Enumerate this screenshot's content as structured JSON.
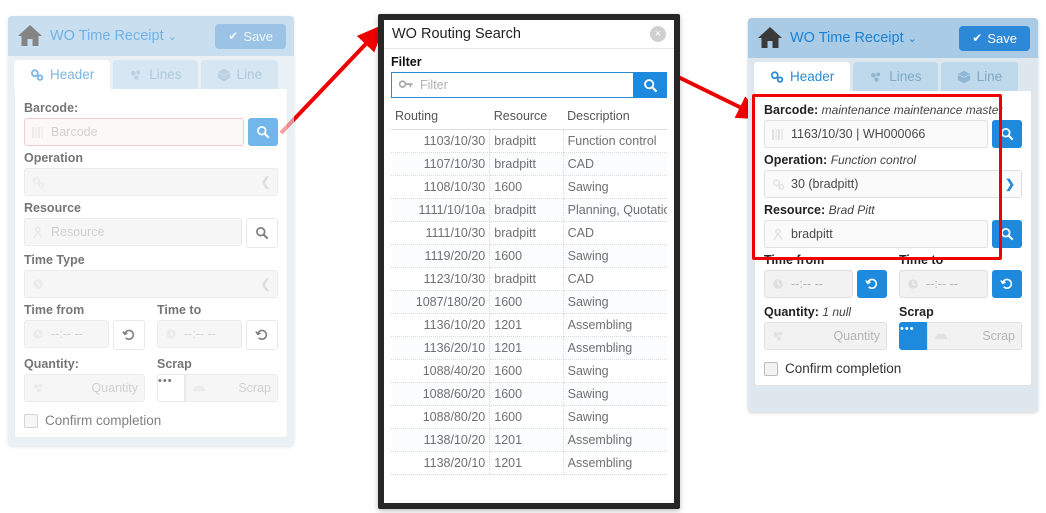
{
  "app": {
    "title": "WO Time Receipt",
    "caret": "⌄",
    "save_label": "Save",
    "home_icon": "home-icon",
    "tabs": [
      {
        "label": "Header",
        "icon": "gears-icon",
        "active": true
      },
      {
        "label": "Lines",
        "icon": "molecule-icon",
        "active": false
      },
      {
        "label": "Line",
        "icon": "box-icon",
        "active": false
      }
    ]
  },
  "left_panel": {
    "barcode": {
      "label": "Barcode:",
      "placeholder": "Barcode",
      "value": "",
      "icon": "barcode-icon",
      "search_icon": "search-icon"
    },
    "operation": {
      "label": "Operation",
      "placeholder": "",
      "value": "",
      "icon": "gears-icon",
      "chevron": "chevron-down-icon"
    },
    "resource": {
      "label": "Resource",
      "placeholder": "Resource",
      "value": "",
      "icon": "person-icon",
      "search_icon": "search-icon"
    },
    "time_type": {
      "label": "Time Type",
      "placeholder": "",
      "value": "",
      "icon": "clock-icon",
      "chevron": "chevron-down-icon"
    },
    "time_from": {
      "label": "Time from",
      "placeholder": "--:-- --",
      "value": "",
      "icon": "clock-icon",
      "button_icon": "history-icon"
    },
    "time_to": {
      "label": "Time to",
      "placeholder": "--:-- --",
      "value": "",
      "icon": "clock-icon",
      "button_icon": "history-icon"
    },
    "quantity": {
      "label": "Quantity:",
      "placeholder": "Quantity",
      "value": "",
      "icon": "cubes-icon"
    },
    "scrap": {
      "label": "Scrap",
      "placeholder": "Scrap",
      "value": "",
      "icon": "scrap-icon",
      "dots_label": "•••"
    },
    "confirm": {
      "label": "Confirm completion",
      "checked": false
    }
  },
  "modal": {
    "title": "WO Routing Search",
    "close_label": "×",
    "filter_label": "Filter",
    "filter_placeholder": "Filter",
    "filter_value": "",
    "filter_icon": "key-icon",
    "search_icon": "search-icon",
    "columns": [
      "Routing",
      "Resource",
      "Description"
    ],
    "rows": [
      [
        "1103/10/30",
        "bradpitt",
        "Function control"
      ],
      [
        "1107/10/30",
        "bradpitt",
        "CAD"
      ],
      [
        "1108/10/30",
        "1600",
        "Sawing"
      ],
      [
        "1111/10/10a",
        "bradpitt",
        "Planning, Quotation"
      ],
      [
        "1111/10/30",
        "bradpitt",
        "CAD"
      ],
      [
        "1119/20/20",
        "1600",
        "Sawing"
      ],
      [
        "1123/10/30",
        "bradpitt",
        "CAD"
      ],
      [
        "1087/180/20",
        "1600",
        "Sawing"
      ],
      [
        "1136/10/20",
        "1201",
        "Assembling"
      ],
      [
        "1136/20/10",
        "1201",
        "Assembling"
      ],
      [
        "1088/40/20",
        "1600",
        "Sawing"
      ],
      [
        "1088/60/20",
        "1600",
        "Sawing"
      ],
      [
        "1088/80/20",
        "1600",
        "Sawing"
      ],
      [
        "1138/10/20",
        "1201",
        "Assembling"
      ],
      [
        "1138/20/10",
        "1201",
        "Assembling"
      ]
    ]
  },
  "right_panel": {
    "barcode": {
      "label": "Barcode:",
      "sub": "maintenance maintenance master",
      "value": "1163/10/30 | WH000066",
      "icon": "barcode-icon",
      "search_icon": "search-icon"
    },
    "operation": {
      "label": "Operation:",
      "sub": "Function control",
      "value": "30 (bradpitt)",
      "icon": "gears-icon",
      "chevron": "chevron-down-icon"
    },
    "resource": {
      "label": "Resource:",
      "sub": "Brad Pitt",
      "value": "bradpitt",
      "icon": "person-icon",
      "search_icon": "search-icon"
    },
    "time_from": {
      "label": "Time from",
      "placeholder": "--:-- --",
      "value": "",
      "icon": "clock-icon",
      "button_icon": "history-icon"
    },
    "time_to": {
      "label": "Time to",
      "placeholder": "--:-- --",
      "value": "",
      "icon": "clock-icon",
      "button_icon": "history-icon"
    },
    "quantity": {
      "label": "Quantity:",
      "sub": "1 null",
      "placeholder": "Quantity",
      "value": "",
      "icon": "cubes-icon"
    },
    "scrap": {
      "label": "Scrap",
      "placeholder": "Scrap",
      "value": "",
      "icon": "scrap-icon",
      "dots_label": "•••"
    },
    "confirm": {
      "label": "Confirm completion",
      "checked": false
    }
  },
  "annotations": {
    "arrow1": "arrow-left-panel-to-modal",
    "arrow2": "arrow-modal-to-right-panel",
    "highlight": "red-highlight-box",
    "arrow_color": "#ee0000"
  }
}
